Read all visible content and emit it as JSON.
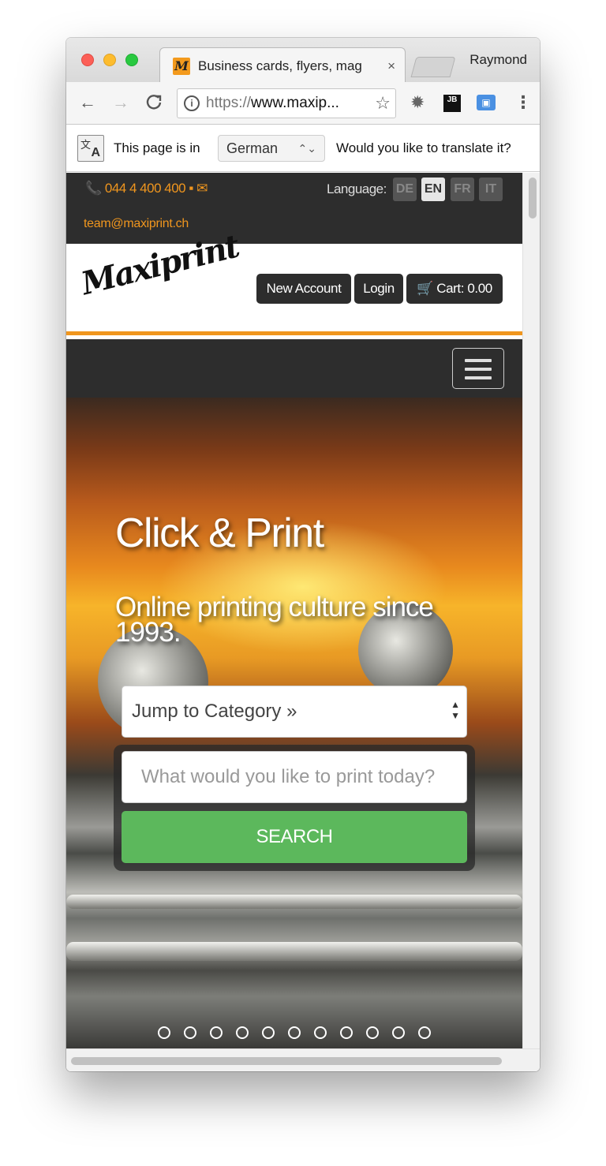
{
  "browser": {
    "tab_title": "Business cards, flyers, mag",
    "tab_favicon_letter": "M",
    "tab_close": "×",
    "profile_name": "Raymond",
    "url_scheme": "https://",
    "url_host": "www.maxip...",
    "nav": {
      "back": "←",
      "forward": "→",
      "reload": "C"
    },
    "star": "☆",
    "menu": "⋮",
    "ext_jb_label": "JB"
  },
  "translate_bar": {
    "prefix": "This page is in",
    "language": "German",
    "question": "Would you like to translate it?"
  },
  "site": {
    "phone": "📞 044 4 400 400 ▪ ✉",
    "email": "team@maxiprint.ch",
    "language_label": "Language:",
    "languages": [
      "DE",
      "EN",
      "FR",
      "IT"
    ],
    "active_language": "EN",
    "logo_text": "Maxiprint",
    "header_buttons": {
      "new_account": "New Account",
      "login": "Login",
      "cart": "🛒 Cart: 0.00"
    },
    "hero": {
      "title": "Click & Print",
      "subtitle": "Online printing culture since 1993.",
      "category_select": "Jump to Category »",
      "search_placeholder": "What would you like to print today?",
      "search_button": "SEARCH",
      "slide_count": 11
    }
  },
  "colors": {
    "accent": "#f0961e",
    "dark": "#2d2d2d",
    "search_green": "#5cb85c"
  }
}
